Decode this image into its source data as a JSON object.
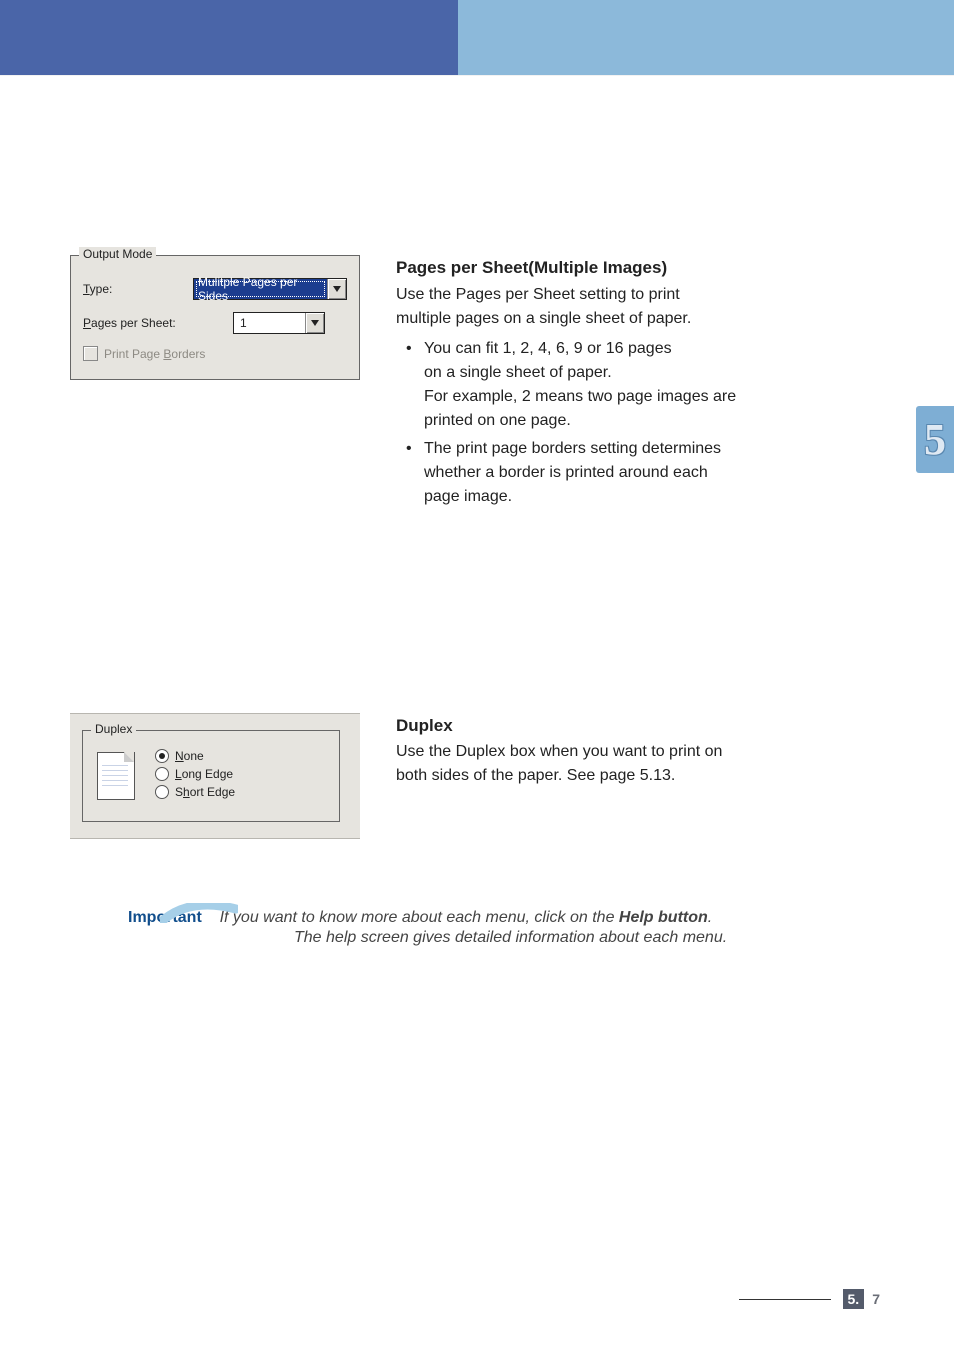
{
  "chapter_tab": "5",
  "output_mode": {
    "legend": "Output Mode",
    "type_label_pre": "T",
    "type_label_post": "ype:",
    "type_value": "Mulitple Pages per Sides",
    "pps_label_pre": "P",
    "pps_label_post": "ages per Sheet:",
    "pps_value": "1",
    "ppb_label": "Print Page Borders",
    "ppb_pre": "Print Page ",
    "ppb_key": "B",
    "ppb_post": "orders"
  },
  "section1": {
    "heading": "Pages per Sheet(Multiple Images)",
    "intro1": "Use the Pages per Sheet setting to print",
    "intro2": "multiple pages on a single sheet of paper.",
    "b1a": "You can fit 1, 2, 4, 6, 9 or 16 pages",
    "b1b": "on a single sheet of paper.",
    "b1c": "For example, 2 means two page images are",
    "b1d": "printed on one page.",
    "b2a": "The print page borders setting determines",
    "b2b": "whether a border is printed around each",
    "b2c": "page image."
  },
  "duplex_box": {
    "legend": "Duplex",
    "r1_pre": "N",
    "r1_post": "one",
    "r2_pre": "L",
    "r2_post": "ong Edge",
    "r3_pre": "h",
    "r3_prefix": "S",
    "r3_post": "ort Edge"
  },
  "section2": {
    "heading": "Duplex",
    "line1": "Use the Duplex box when you want to print on",
    "line2": "both sides of the paper. See page 5.13."
  },
  "note": {
    "lead": "Important",
    "t1": "If you want to know more about each menu, click on the ",
    "helpb": "Help button",
    "t2": ".",
    "line2": "The help screen gives detailed information about each menu."
  },
  "footer": {
    "major": "5.",
    "minor": "7"
  }
}
